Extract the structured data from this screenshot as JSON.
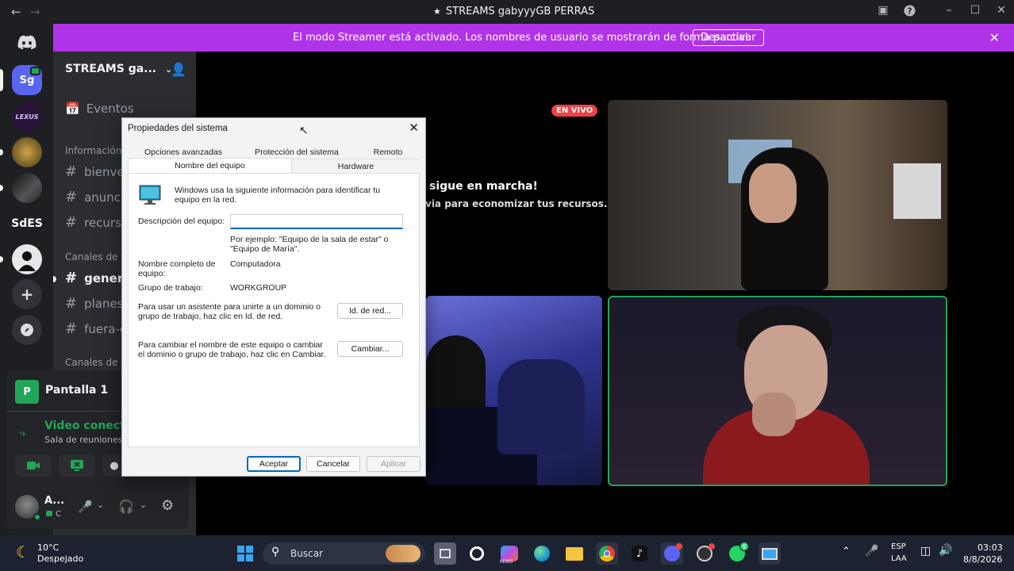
{
  "window": {
    "title": "STREAMS gabyyyGB PERRAS"
  },
  "banner": {
    "text": "El modo Streamer está activado. Los nombres de usuario se mostrarán de forma parcial.",
    "button": "Desactivar"
  },
  "servers": [
    {
      "label": "Sg",
      "color": "#5865f2"
    },
    {
      "label": "LEXUS",
      "color": "#2a1538"
    },
    {
      "label": "",
      "color": "#6b5520"
    },
    {
      "label": "",
      "color": "#222"
    },
    {
      "label": "SdES",
      "color": "#1e1f22"
    },
    {
      "label": "",
      "color": "#ddd"
    }
  ],
  "channels": {
    "guild_name": "STREAMS ga...",
    "events_label": "Eventos",
    "categories": {
      "info": "Información",
      "text": "Canales de t",
      "voice": "Canales de v"
    },
    "info_channels": [
      "bienve",
      "anunci",
      "recurso"
    ],
    "text_channels": [
      "genera",
      "planes",
      "fuera-c"
    ]
  },
  "voice_panel": {
    "screen_label": "Pantalla 1",
    "status": "Video conectad",
    "room": "Sala de reuniones ...",
    "user_name": "A...",
    "user_status": "C"
  },
  "stream": {
    "live_badge": "EN VIVO",
    "msg_title": "sigue en marcha!",
    "msg_sub": "via para economizar tus recursos."
  },
  "dialog": {
    "title": "Propiedades del sistema",
    "tabs_row1": [
      "Opciones avanzadas",
      "Protección del sistema",
      "Remoto"
    ],
    "tabs_row2": [
      "Nombre del equipo",
      "Hardware"
    ],
    "intro": "Windows usa la siguiente información para identificar tu equipo en la red.",
    "desc_label": "Descripción del equipo:",
    "desc_value": "",
    "example": "Por ejemplo: \"Equipo de la sala de estar\" o \"Equipo de María\".",
    "fullname_label": "Nombre completo de equipo:",
    "fullname_value": "Computadora",
    "workgroup_label": "Grupo de trabajo:",
    "workgroup_value": "WORKGROUP",
    "netid_text": "Para usar un asistente para unirte a un dominio o grupo de trabajo, haz clic en Id. de red.",
    "netid_button": "Id. de red...",
    "change_text": "Para cambiar el nombre de este equipo o cambiar el dominio o grupo de trabajo, haz clic en Cambiar.",
    "change_button": "Cambiar...",
    "ok": "Aceptar",
    "cancel": "Cancelar",
    "apply": "Aplicar"
  },
  "taskbar": {
    "temp": "10°C",
    "weather": "Despejado",
    "search": "Buscar",
    "lang1": "ESP",
    "lang2": "LAA",
    "time": "03:03",
    "date": "8/8/2026",
    "whatsapp_badge": "9",
    "m365_label": "M365"
  },
  "colors": {
    "discord_bg": "#1e1f22",
    "banner": "#b033e8",
    "green": "#23a559",
    "live_red": "#ed4245"
  }
}
